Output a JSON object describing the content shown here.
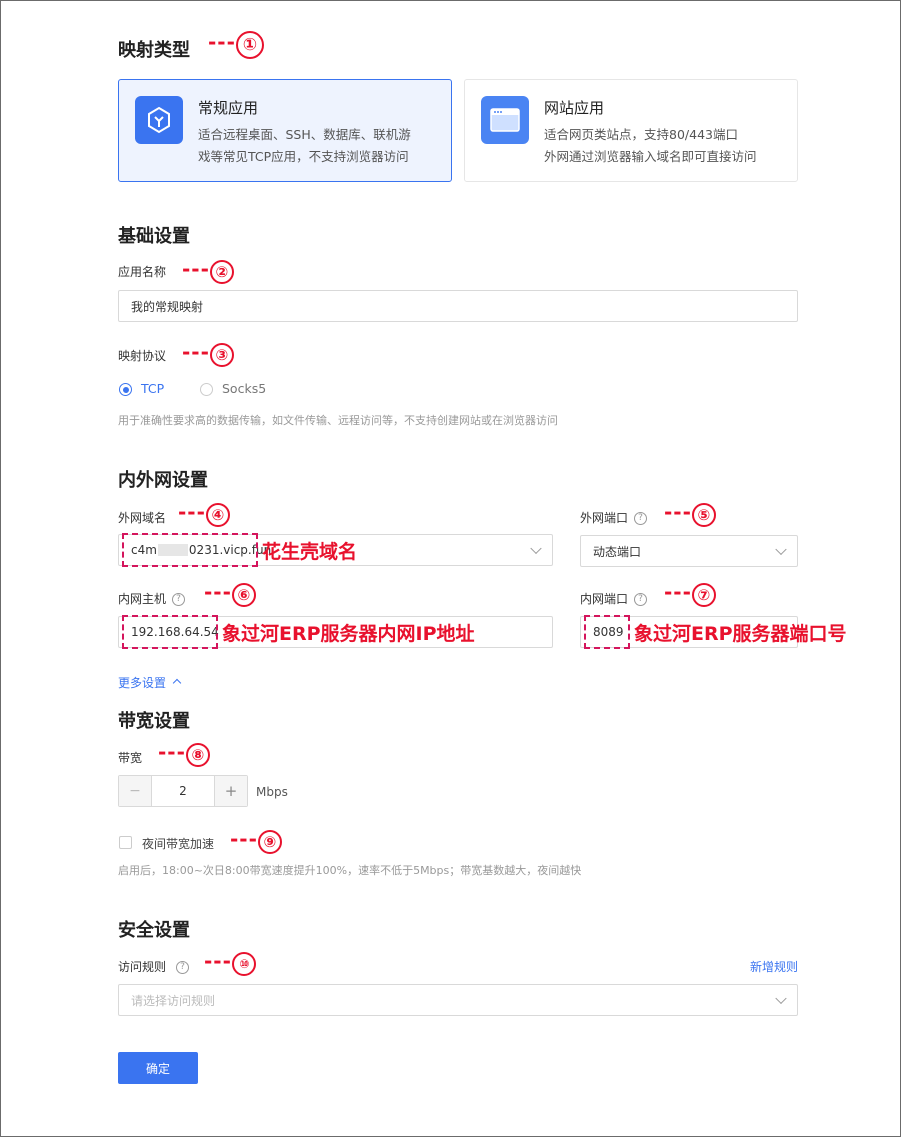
{
  "mapping_type": {
    "title": "映射类型",
    "cards": [
      {
        "title": "常规应用",
        "desc_line1": "适合远程桌面、SSH、数据库、联机游",
        "desc_line2": "戏等常见TCP应用，不支持浏览器访问",
        "selected": true,
        "icon": "cube-icon"
      },
      {
        "title": "网站应用",
        "desc_line1": "适合网页类站点，支持80/443端口",
        "desc_line2": "外网通过浏览器输入域名即可直接访问",
        "selected": false,
        "icon": "browser-window-icon"
      }
    ]
  },
  "basic_settings": {
    "title": "基础设置",
    "app_name_label": "应用名称",
    "app_name_value": "我的常规映射",
    "protocol_label": "映射协议",
    "protocol_options": [
      "TCP",
      "Socks5"
    ],
    "protocol_selected": "TCP",
    "protocol_hint": "用于准确性要求高的数据传输，如文件传输、远程访问等，不支持创建网站或在浏览器访问"
  },
  "network_settings": {
    "title": "内外网设置",
    "external_domain_label": "外网域名",
    "external_domain_prefix": "c4m",
    "external_domain_suffix": "0231.vicp.fun",
    "external_port_label": "外网端口",
    "external_port_value": "动态端口",
    "internal_host_label": "内网主机",
    "internal_host_value": "192.168.64.54",
    "internal_port_label": "内网端口",
    "internal_port_value": "8089",
    "more_settings": "更多设置"
  },
  "bandwidth_settings": {
    "title": "带宽设置",
    "bandwidth_label": "带宽",
    "bandwidth_value": "2",
    "bandwidth_unit": "Mbps",
    "minus": "−",
    "plus": "+",
    "night_boost_label": "夜间带宽加速",
    "night_boost_checked": false,
    "night_boost_hint": "启用后，18:00~次日8:00带宽速度提升100%，速率不低于5Mbps；带宽基数越大，夜间越快"
  },
  "security_settings": {
    "title": "安全设置",
    "access_rule_label": "访问规则",
    "add_rule": "新增规则",
    "access_rule_placeholder": "请选择访问规则"
  },
  "confirm_button": "确定",
  "annotations": {
    "dash": "---",
    "n1": "①",
    "n2": "②",
    "n3": "③",
    "n4": "④",
    "n5": "⑤",
    "n6": "⑥",
    "n7": "⑦",
    "n8": "⑧",
    "n9": "⑨",
    "n10": "⑩",
    "domain_note": "花生壳域名",
    "host_note": "象过河ERP服务器内网IP地址",
    "port_note": "象过河ERP服务器端口号"
  },
  "colors": {
    "accent": "#3a74f0",
    "annotation_red": "#e8112d",
    "dash_box": "#d4155c"
  }
}
